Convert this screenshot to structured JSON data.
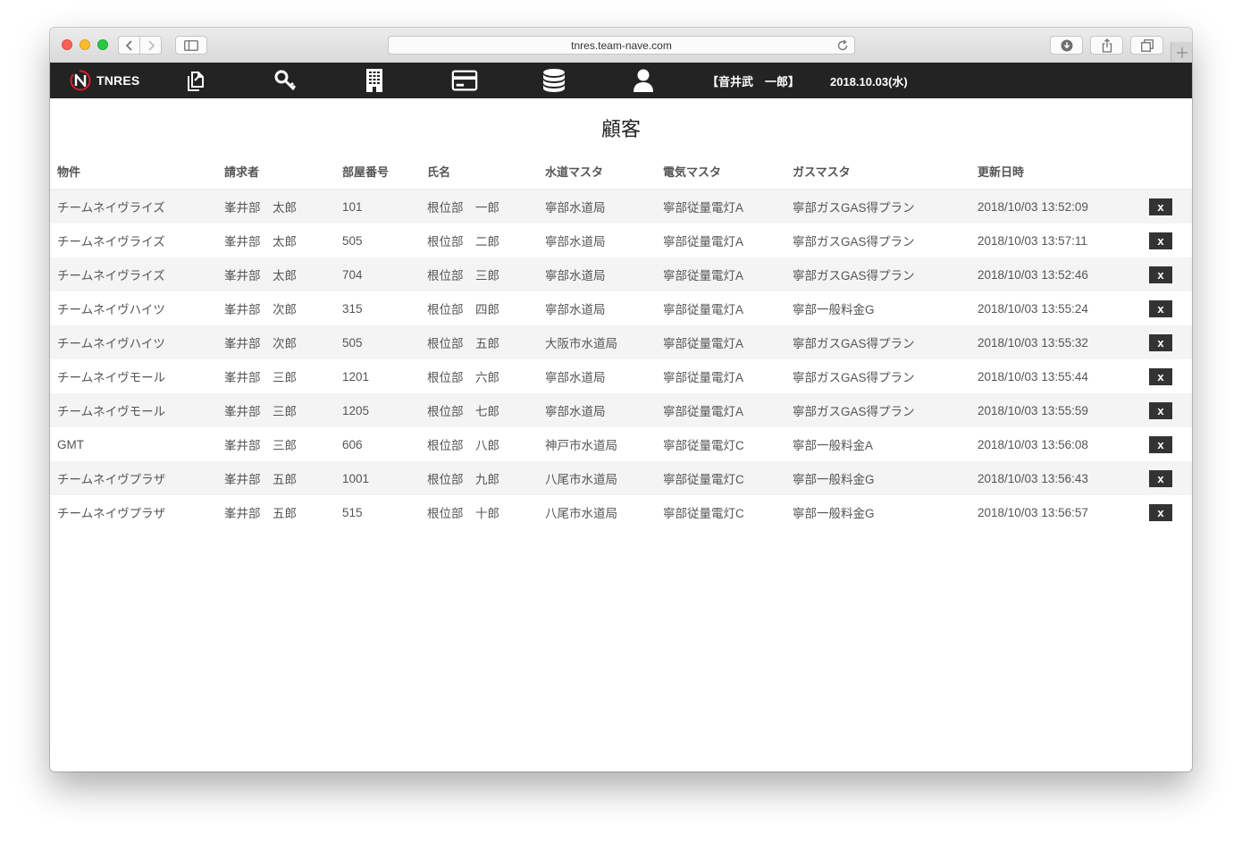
{
  "browser": {
    "url": "tnres.team-nave.com"
  },
  "navbar": {
    "brand": "TNRES",
    "icons": [
      "documents-icon",
      "key-icon",
      "building-icon",
      "card-icon",
      "database-icon",
      "user-icon"
    ],
    "user": "【音井武　一郎】",
    "date": "2018.10.03(水)",
    "background": "#232323",
    "logo_accent": "#d0202e"
  },
  "page": {
    "title": "顧客"
  },
  "table": {
    "headers": [
      "物件",
      "請求者",
      "部屋番号",
      "氏名",
      "水道マスタ",
      "電気マスタ",
      "ガスマスタ",
      "更新日時"
    ],
    "delete_label": "x",
    "rows": [
      [
        "チームネイヴライズ",
        "峯井部　太郎",
        "101",
        "根位部　一郎",
        "寧部水道局",
        "寧部従量電灯A",
        "寧部ガスGAS得プラン",
        "2018/10/03 13:52:09"
      ],
      [
        "チームネイヴライズ",
        "峯井部　太郎",
        "505",
        "根位部　二郎",
        "寧部水道局",
        "寧部従量電灯A",
        "寧部ガスGAS得プラン",
        "2018/10/03 13:57:11"
      ],
      [
        "チームネイヴライズ",
        "峯井部　太郎",
        "704",
        "根位部　三郎",
        "寧部水道局",
        "寧部従量電灯A",
        "寧部ガスGAS得プラン",
        "2018/10/03 13:52:46"
      ],
      [
        "チームネイヴハイツ",
        "峯井部　次郎",
        "315",
        "根位部　四郎",
        "寧部水道局",
        "寧部従量電灯A",
        "寧部一般料金G",
        "2018/10/03 13:55:24"
      ],
      [
        "チームネイヴハイツ",
        "峯井部　次郎",
        "505",
        "根位部　五郎",
        "大阪市水道局",
        "寧部従量電灯A",
        "寧部ガスGAS得プラン",
        "2018/10/03 13:55:32"
      ],
      [
        "チームネイヴモール",
        "峯井部　三郎",
        "1201",
        "根位部　六郎",
        "寧部水道局",
        "寧部従量電灯A",
        "寧部ガスGAS得プラン",
        "2018/10/03 13:55:44"
      ],
      [
        "チームネイヴモール",
        "峯井部　三郎",
        "1205",
        "根位部　七郎",
        "寧部水道局",
        "寧部従量電灯A",
        "寧部ガスGAS得プラン",
        "2018/10/03 13:55:59"
      ],
      [
        "GMT",
        "峯井部　三郎",
        "606",
        "根位部　八郎",
        "神戸市水道局",
        "寧部従量電灯C",
        "寧部一般料金A",
        "2018/10/03 13:56:08"
      ],
      [
        "チームネイヴプラザ",
        "峯井部　五郎",
        "1001",
        "根位部　九郎",
        "八尾市水道局",
        "寧部従量電灯C",
        "寧部一般料金G",
        "2018/10/03 13:56:43"
      ],
      [
        "チームネイヴプラザ",
        "峯井部　五郎",
        "515",
        "根位部　十郎",
        "八尾市水道局",
        "寧部従量電灯C",
        "寧部一般料金G",
        "2018/10/03 13:56:57"
      ]
    ]
  }
}
